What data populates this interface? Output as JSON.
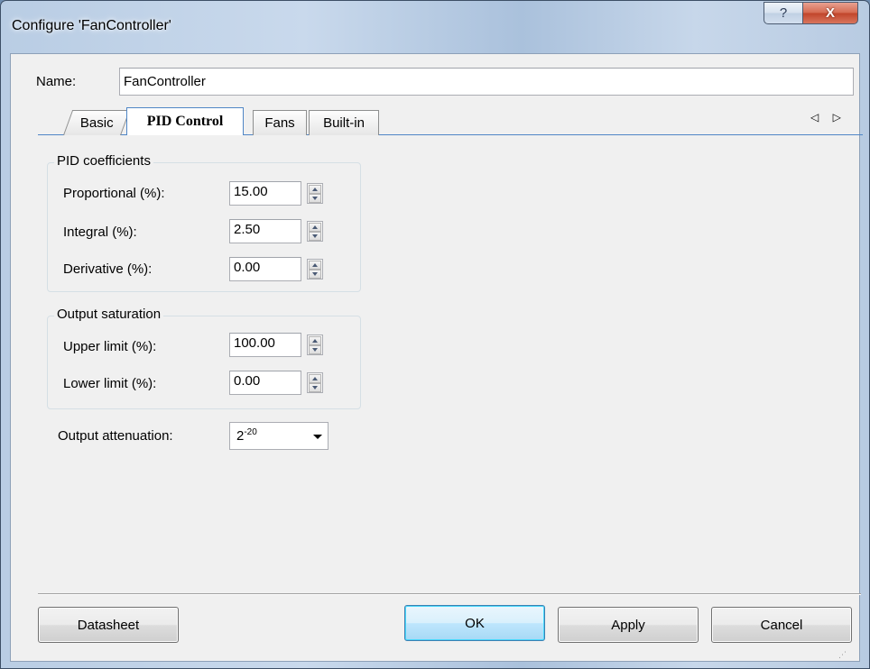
{
  "window": {
    "title": "Configure 'FanController'",
    "help_glyph": "?",
    "close_glyph": "X"
  },
  "name_field": {
    "label": "Name:",
    "value": "FanController"
  },
  "tabs": [
    {
      "label": "Basic",
      "active": false
    },
    {
      "label": "PID Control",
      "active": true
    },
    {
      "label": "Fans",
      "active": false
    },
    {
      "label": "Built-in",
      "active": false
    }
  ],
  "tab_scroll_arrows": "◁ ▷",
  "pid_coefficients": {
    "title": "PID coefficients",
    "proportional": {
      "label": "Proportional (%):",
      "value": "15.00"
    },
    "integral": {
      "label": "Integral (%):",
      "value": "2.50"
    },
    "derivative": {
      "label": "Derivative (%):",
      "value": "0.00"
    }
  },
  "output_saturation": {
    "title": "Output saturation",
    "upper_limit": {
      "label": "Upper limit (%):",
      "value": "100.00"
    },
    "lower_limit": {
      "label": "Lower limit (%):",
      "value": "0.00"
    }
  },
  "output_attenuation": {
    "label": "Output attenuation:",
    "value_base": "2",
    "value_exponent": "-20"
  },
  "buttons": {
    "datasheet": "Datasheet",
    "ok": "OK",
    "apply": "Apply",
    "cancel": "Cancel"
  },
  "colors": {
    "accent": "#4f86c6",
    "default_button": "#3c7fb1",
    "close_button": "#c1442a"
  }
}
